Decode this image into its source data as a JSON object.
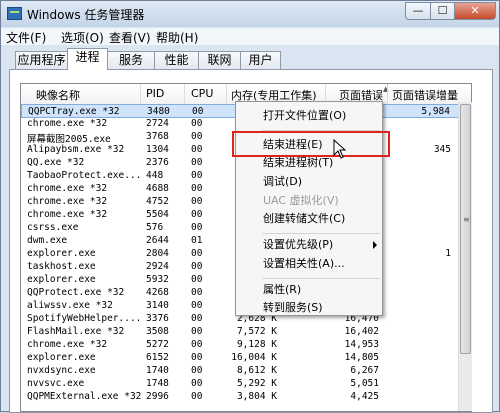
{
  "window": {
    "title": "Windows 任务管理器",
    "min_glyph": "—",
    "max_glyph": "☐",
    "close_glyph": "✕"
  },
  "menubar": [
    {
      "label": "文件(F)"
    },
    {
      "label": "选项(O)"
    },
    {
      "label": "查看(V)"
    },
    {
      "label": "帮助(H)"
    }
  ],
  "tabs": [
    {
      "label": "应用程序"
    },
    {
      "label": "进程",
      "active": true
    },
    {
      "label": "服务"
    },
    {
      "label": "性能"
    },
    {
      "label": "联网"
    },
    {
      "label": "用户"
    }
  ],
  "columns": [
    {
      "label": "映像名称"
    },
    {
      "label": "PID"
    },
    {
      "label": "CPU"
    },
    {
      "label": "内存(专用工作集)"
    },
    {
      "label": "页面错误"
    },
    {
      "label": "页面错误增量"
    }
  ],
  "rows": [
    {
      "name": "QQPCTray.exe *32",
      "pid": "3480",
      "cpu": "00",
      "mem": "",
      "pf": "",
      "pfd": "5,984",
      "selected": true
    },
    {
      "name": "chrome.exe *32",
      "pid": "2724",
      "cpu": "00",
      "mem": "",
      "pf": "",
      "pfd": ""
    },
    {
      "name": "屏幕截图2005.exe",
      "pid": "3768",
      "cpu": "00",
      "mem": "",
      "pf": "",
      "pfd": ""
    },
    {
      "name": "Alipaybsm.exe *32",
      "pid": "1304",
      "cpu": "00",
      "mem": "",
      "pf": "",
      "pfd": "345"
    },
    {
      "name": "QQ.exe *32",
      "pid": "2376",
      "cpu": "00",
      "mem": "",
      "pf": "",
      "pfd": ""
    },
    {
      "name": "TaobaoProtect.exe...",
      "pid": "448",
      "cpu": "00",
      "mem": "",
      "pf": "",
      "pfd": ""
    },
    {
      "name": "chrome.exe *32",
      "pid": "4688",
      "cpu": "00",
      "mem": "",
      "pf": "",
      "pfd": ""
    },
    {
      "name": "chrome.exe *32",
      "pid": "4752",
      "cpu": "00",
      "mem": "",
      "pf": "",
      "pfd": ""
    },
    {
      "name": "chrome.exe *32",
      "pid": "5504",
      "cpu": "00",
      "mem": "",
      "pf": "",
      "pfd": ""
    },
    {
      "name": "csrss.exe",
      "pid": "576",
      "cpu": "00",
      "mem": "",
      "pf": "",
      "pfd": ""
    },
    {
      "name": "dwm.exe",
      "pid": "2644",
      "cpu": "01",
      "mem": "",
      "pf": "",
      "pfd": ""
    },
    {
      "name": "explorer.exe",
      "pid": "2804",
      "cpu": "00",
      "mem": "",
      "pf": "",
      "pfd": "1"
    },
    {
      "name": "taskhost.exe",
      "pid": "2924",
      "cpu": "00",
      "mem": "",
      "pf": "",
      "pfd": ""
    },
    {
      "name": "explorer.exe",
      "pid": "5932",
      "cpu": "00",
      "mem": "",
      "pf": "",
      "pfd": ""
    },
    {
      "name": "QQProtect.exe *32",
      "pid": "4268",
      "cpu": "00",
      "mem": "",
      "pf": "",
      "pfd": ""
    },
    {
      "name": "aliwssv.exe *32",
      "pid": "3140",
      "cpu": "00",
      "mem": "",
      "pf": "",
      "pfd": ""
    },
    {
      "name": "SpotifyWebHelper....",
      "pid": "3376",
      "cpu": "00",
      "mem": "2,628 K",
      "pf": "16,470",
      "pfd": ""
    },
    {
      "name": "FlashMail.exe *32",
      "pid": "3508",
      "cpu": "00",
      "mem": "7,572 K",
      "pf": "16,402",
      "pfd": ""
    },
    {
      "name": "chrome.exe *32",
      "pid": "5272",
      "cpu": "00",
      "mem": "9,128 K",
      "pf": "14,953",
      "pfd": ""
    },
    {
      "name": "explorer.exe",
      "pid": "6152",
      "cpu": "00",
      "mem": "16,004 K",
      "pf": "14,805",
      "pfd": ""
    },
    {
      "name": "nvxdsync.exe",
      "pid": "1740",
      "cpu": "00",
      "mem": "8,612 K",
      "pf": "6,267",
      "pfd": ""
    },
    {
      "name": "nvvsvc.exe",
      "pid": "1748",
      "cpu": "00",
      "mem": "5,292 K",
      "pf": "5,051",
      "pfd": ""
    },
    {
      "name": "QQPMExternal.exe *32",
      "pid": "2996",
      "cpu": "00",
      "mem": "3,804 K",
      "pf": "4,425",
      "pfd": ""
    }
  ],
  "context_menu": [
    {
      "label": "打开文件位置(O)"
    },
    {
      "label": "结束进程(E)"
    },
    {
      "label": "结束进程树(T)"
    },
    {
      "label": "调试(D)"
    },
    {
      "label": "UAC 虚拟化(V)",
      "disabled": true
    },
    {
      "label": "创建转储文件(C)"
    },
    {
      "label": "设置优先级(P)"
    },
    {
      "label": "设置相关性(A)..."
    },
    {
      "label": "属性(R)"
    },
    {
      "label": "转到服务(S)"
    }
  ],
  "colors": {
    "highlight_box": "#e2231a",
    "selected_row": "#cfe3fb"
  },
  "icons": {
    "cursor": "arrow-cursor-icon",
    "sort": "sort-up-icon",
    "submenu": "submenu-arrow-icon"
  }
}
